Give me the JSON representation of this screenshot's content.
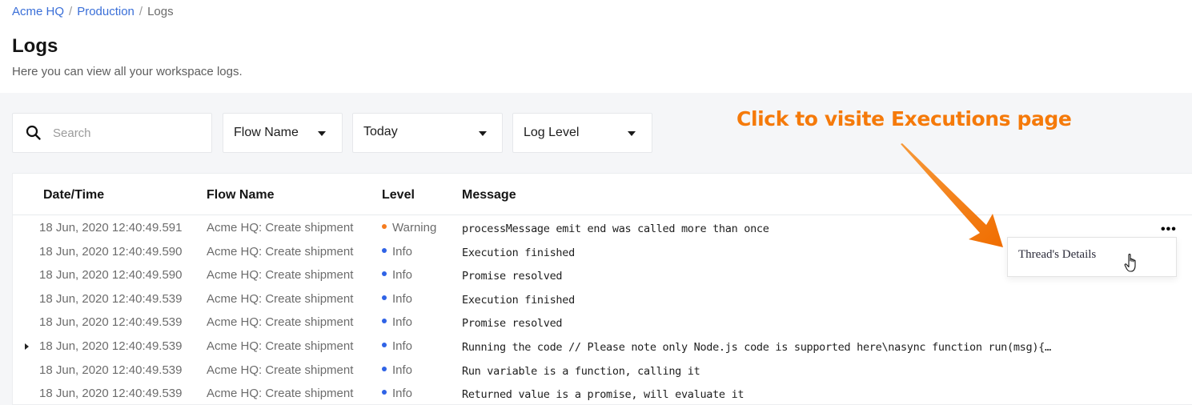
{
  "breadcrumb": {
    "items": [
      "Acme HQ",
      "Production",
      "Logs"
    ],
    "separator": "/"
  },
  "page": {
    "title": "Logs",
    "subtitle": "Here you can view all your workspace logs."
  },
  "filters": {
    "search": {
      "placeholder": "Search",
      "value": "",
      "icon": "search-icon"
    },
    "flow_name": {
      "selected": "Flow Name"
    },
    "date_range": {
      "selected": "Today"
    },
    "log_level": {
      "selected": "Log Level"
    }
  },
  "table": {
    "columns": [
      "Date/Time",
      "Flow Name",
      "Level",
      "Message"
    ],
    "rows": [
      {
        "datetime": "18 Jun, 2020 12:40:49.591",
        "flow": "Acme HQ: Create shipment",
        "level": "Warning",
        "message": "processMessage emit end was called more than once",
        "expandable": false
      },
      {
        "datetime": "18 Jun, 2020 12:40:49.590",
        "flow": "Acme HQ: Create shipment",
        "level": "Info",
        "message": "Execution finished",
        "expandable": false
      },
      {
        "datetime": "18 Jun, 2020 12:40:49.590",
        "flow": "Acme HQ: Create shipment",
        "level": "Info",
        "message": "Promise resolved",
        "expandable": false
      },
      {
        "datetime": "18 Jun, 2020 12:40:49.539",
        "flow": "Acme HQ: Create shipment",
        "level": "Info",
        "message": "Execution finished",
        "expandable": false
      },
      {
        "datetime": "18 Jun, 2020 12:40:49.539",
        "flow": "Acme HQ: Create shipment",
        "level": "Info",
        "message": "Promise resolved",
        "expandable": false
      },
      {
        "datetime": "18 Jun, 2020 12:40:49.539",
        "flow": "Acme HQ: Create shipment",
        "level": "Info",
        "message": "Running the code // Please note only Node.js code is supported here\\nasync function run(msg){…",
        "expandable": true
      },
      {
        "datetime": "18 Jun, 2020 12:40:49.539",
        "flow": "Acme HQ: Create shipment",
        "level": "Info",
        "message": "Run variable is a function, calling it",
        "expandable": false
      },
      {
        "datetime": "18 Jun, 2020 12:40:49.539",
        "flow": "Acme HQ: Create shipment",
        "level": "Info",
        "message": "Returned value is a promise, will evaluate it",
        "expandable": false
      }
    ],
    "more_button": "•••"
  },
  "context_menu": {
    "items": [
      "Thread's Details"
    ]
  },
  "annotation": {
    "text": "Click to visite Executions page"
  },
  "colors": {
    "link": "#3a6fd8",
    "warning": "#f57c1f",
    "info": "#2f63e6",
    "annotation": "#f57a0a",
    "background": "#f5f6f8"
  }
}
